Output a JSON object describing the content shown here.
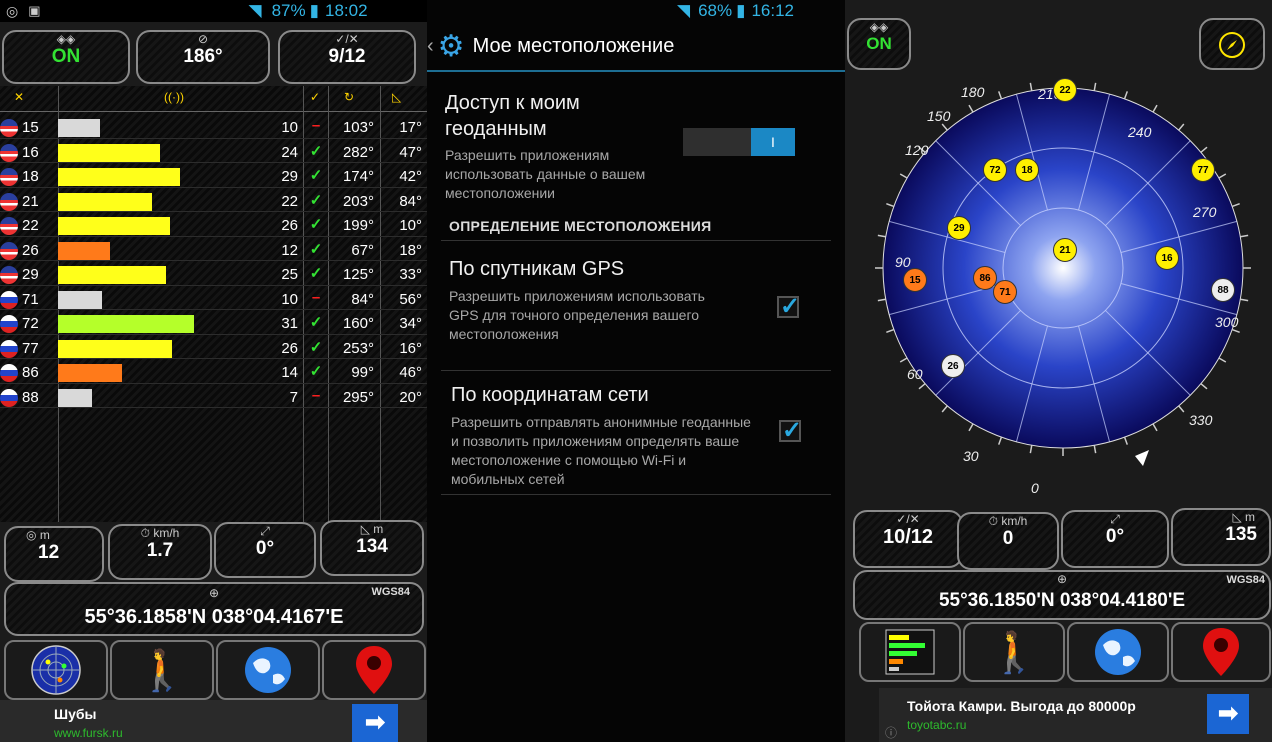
{
  "left": {
    "status": {
      "battery": "87%",
      "time": "18:02"
    },
    "top_boxes": [
      {
        "value": "ON"
      },
      {
        "value": "186°"
      },
      {
        "value": "9/12"
      }
    ],
    "satellites": [
      {
        "flag": "us",
        "num": "15",
        "snr": "10",
        "used": "–",
        "az": "103°",
        "el": "17°",
        "bar_fraction": 0.21,
        "bar_color": "#d9d9d9"
      },
      {
        "flag": "us",
        "num": "16",
        "snr": "24",
        "used": "✓",
        "az": "282°",
        "el": "47°",
        "bar_fraction": 0.51,
        "bar_color": "#ffff1a"
      },
      {
        "flag": "us",
        "num": "18",
        "snr": "29",
        "used": "✓",
        "az": "174°",
        "el": "42°",
        "bar_fraction": 0.61,
        "bar_color": "#ffff1a"
      },
      {
        "flag": "us",
        "num": "21",
        "snr": "22",
        "used": "✓",
        "az": "203°",
        "el": "84°",
        "bar_fraction": 0.47,
        "bar_color": "#ffff1a"
      },
      {
        "flag": "us",
        "num": "22",
        "snr": "26",
        "used": "✓",
        "az": "199°",
        "el": "10°",
        "bar_fraction": 0.56,
        "bar_color": "#ffff1a"
      },
      {
        "flag": "us",
        "num": "26",
        "snr": "12",
        "used": "✓",
        "az": "67°",
        "el": "18°",
        "bar_fraction": 0.26,
        "bar_color": "#ff7a1a"
      },
      {
        "flag": "us",
        "num": "29",
        "snr": "25",
        "used": "✓",
        "az": "125°",
        "el": "33°",
        "bar_fraction": 0.54,
        "bar_color": "#ffff1a"
      },
      {
        "flag": "ru",
        "num": "71",
        "snr": "10",
        "used": "–",
        "az": "84°",
        "el": "56°",
        "bar_fraction": 0.22,
        "bar_color": "#d9d9d9"
      },
      {
        "flag": "ru",
        "num": "72",
        "snr": "31",
        "used": "✓",
        "az": "160°",
        "el": "34°",
        "bar_fraction": 0.68,
        "bar_color": "#b5ff2a"
      },
      {
        "flag": "ru",
        "num": "77",
        "snr": "26",
        "used": "✓",
        "az": "253°",
        "el": "16°",
        "bar_fraction": 0.57,
        "bar_color": "#ffff1a"
      },
      {
        "flag": "ru",
        "num": "86",
        "snr": "14",
        "used": "✓",
        "az": "99°",
        "el": "46°",
        "bar_fraction": 0.32,
        "bar_color": "#ff7a1a"
      },
      {
        "flag": "ru",
        "num": "88",
        "snr": "7",
        "used": "–",
        "az": "295°",
        "el": "20°",
        "bar_fraction": 0.17,
        "bar_color": "#d9d9d9"
      }
    ],
    "bottom_boxes": [
      {
        "label": "m",
        "value": "12"
      },
      {
        "label": "km/h",
        "value": "1.7"
      },
      {
        "label": "",
        "value": "0°"
      },
      {
        "label": "m",
        "value": "134"
      }
    ],
    "coords": {
      "datum": "WGS84",
      "text": "55°36.1858'N  038°04.4167'E"
    },
    "ad": {
      "title": "Шубы",
      "link": "www.fursk.ru"
    }
  },
  "middle": {
    "status": {
      "battery": "68%",
      "time": "16:12"
    },
    "title": "Мое местоположение",
    "access": {
      "title": "Доступ к моим геоданным",
      "desc": "Разрешить приложениям использовать данные о вашем местоположении",
      "toggle": "I"
    },
    "section": "ОПРЕДЕЛЕНИЕ МЕСТОПОЛОЖЕНИЯ",
    "gps": {
      "title": "По спутникам GPS",
      "desc": "Разрешить приложениям использовать GPS для точного определения вашего местоположения",
      "checked": true
    },
    "network": {
      "title": "По координатам сети",
      "desc": "Разрешить отправлять анонимные геоданные и позволить приложениям определять ваше местоположение с помощью Wi-Fi и мобильных сетей",
      "checked": true
    }
  },
  "right": {
    "on_label": "ON",
    "degrees": [
      "180",
      "210",
      "240",
      "270",
      "300",
      "330",
      "0",
      "30",
      "60",
      "90",
      "120",
      "150"
    ],
    "sats": [
      {
        "num": "22",
        "color": "y"
      },
      {
        "num": "72",
        "color": "y"
      },
      {
        "num": "18",
        "color": "y"
      },
      {
        "num": "77",
        "color": "y"
      },
      {
        "num": "29",
        "color": "y"
      },
      {
        "num": "21",
        "color": "y"
      },
      {
        "num": "16",
        "color": "y"
      },
      {
        "num": "15",
        "color": "o"
      },
      {
        "num": "86",
        "color": "o"
      },
      {
        "num": "71",
        "color": "o"
      },
      {
        "num": "88",
        "color": "w"
      },
      {
        "num": "26",
        "color": "w"
      }
    ],
    "bottom_boxes": [
      {
        "label": "",
        "value": "10/12"
      },
      {
        "label": "km/h",
        "value": "0"
      },
      {
        "label": "",
        "value": "0°"
      },
      {
        "label": "m",
        "value": "135"
      }
    ],
    "coords": {
      "datum": "WGS84",
      "text": "55°36.1850'N  038°04.4180'E"
    },
    "ad": {
      "title": "Тойота Камри. Выгода до 80000р",
      "link": "toyotabc.ru"
    },
    "colors": {
      "sky_center": "#ffffff",
      "sky_mid": "#2a44c8",
      "sky_edge": "#0a0a5c"
    }
  }
}
